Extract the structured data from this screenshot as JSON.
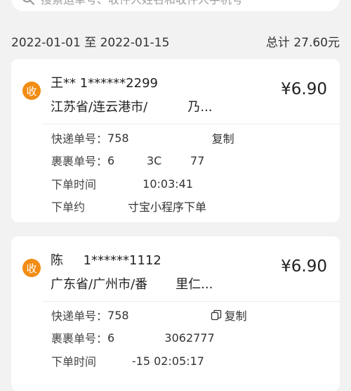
{
  "search": {
    "placeholder": "搜索运单号、收件人姓名和收件人手机号"
  },
  "summary": {
    "date_range": "2022-01-01 至 2022-01-15",
    "total": "总计 27.60元"
  },
  "orders": [
    {
      "badge": "收",
      "name_phone": "王** 1******2299",
      "address": "江苏省/连云港市/          乃...",
      "price": "¥6.90",
      "tracking_label": "快递单号：",
      "tracking_value": "758",
      "copy_label": "复制",
      "order_no_label": "裹裹单号：",
      "order_no_value": "6         3C        77",
      "time_label": "下单时间",
      "time_value": "             10:03:41",
      "channel_label": "下单约",
      "channel_value": "            寸宝小程序下单"
    },
    {
      "badge": "收",
      "name_phone": "陈     1******1112",
      "address": "广东省/广州市/番       里仁...",
      "price": "¥6.90",
      "tracking_label": "快递单号：",
      "tracking_value": "758",
      "copy_label": "复制",
      "order_no_label": "裹裹单号：",
      "order_no_value": "6              3062777",
      "time_label": "下单时间",
      "time_value": "          -15 02:05:17"
    }
  ],
  "colors": {
    "background": "#f2f2f2",
    "card": "#ffffff",
    "badge": "#f28c13",
    "text": "#222222"
  }
}
